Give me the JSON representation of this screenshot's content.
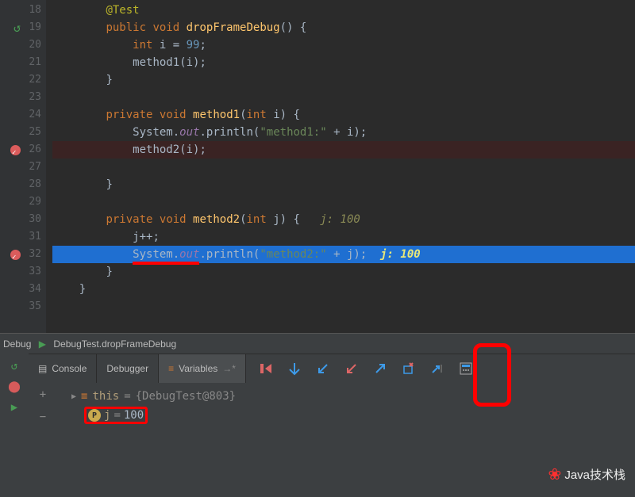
{
  "lines": {
    "start": 18,
    "end": 35,
    "annotation": "@Test",
    "sig_drop": "dropFrameDebug",
    "kw_public": "public",
    "kw_void": "void",
    "kw_private": "private",
    "kw_int": "int",
    "i_decl_var": "i",
    "i_decl_val": "99",
    "call_m1": "method1",
    "call_m2": "method2",
    "m1_name": "method1",
    "m1_param": "i",
    "m2_name": "method2",
    "m2_param": "j",
    "sys": "System",
    "out": "out",
    "println": "println",
    "str_m1": "\"method1:\"",
    "str_m2": "\"method2:\"",
    "jpp": "j++",
    "hint_sig": "j: 100",
    "hint_exec": "j: 100"
  },
  "debug": {
    "panel_label": "Debug",
    "run_config": "DebugTest.dropFrameDebug"
  },
  "tabs": {
    "console": "Console",
    "debugger": "Debugger",
    "variables": "Variables",
    "arrow": "→*"
  },
  "vars": {
    "this_name": "this",
    "this_val": "{DebugTest@803}",
    "j_name": "j",
    "j_val": "100"
  },
  "watermark": "Java技术栈"
}
